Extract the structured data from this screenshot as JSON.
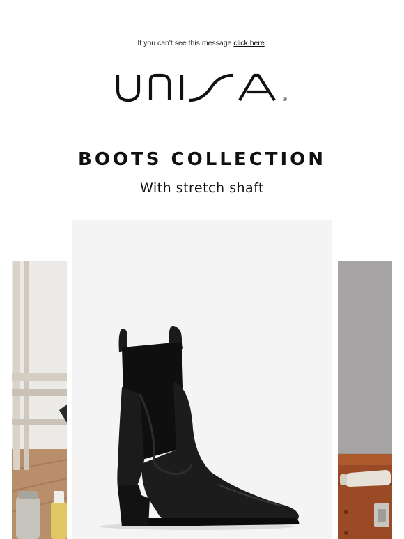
{
  "preheader": {
    "text": "If you can't see this message ",
    "link_label": "click here",
    "suffix": "."
  },
  "brand": {
    "name": "UNISA",
    "registered_mark": "®"
  },
  "hero": {
    "title": "BOOTS COLLECTION",
    "subtitle": "With stretch shaft"
  },
  "carousel": {
    "slides": [
      {
        "name": "lifestyle-left",
        "icon": "easel-image"
      },
      {
        "name": "black-chelsea-boot",
        "icon": "boot-image"
      },
      {
        "name": "lifestyle-right",
        "icon": "case-image"
      }
    ]
  },
  "colors": {
    "background": "#ffffff",
    "text": "#111111",
    "card_background": "#f4f4f4",
    "boot": "#151515"
  }
}
